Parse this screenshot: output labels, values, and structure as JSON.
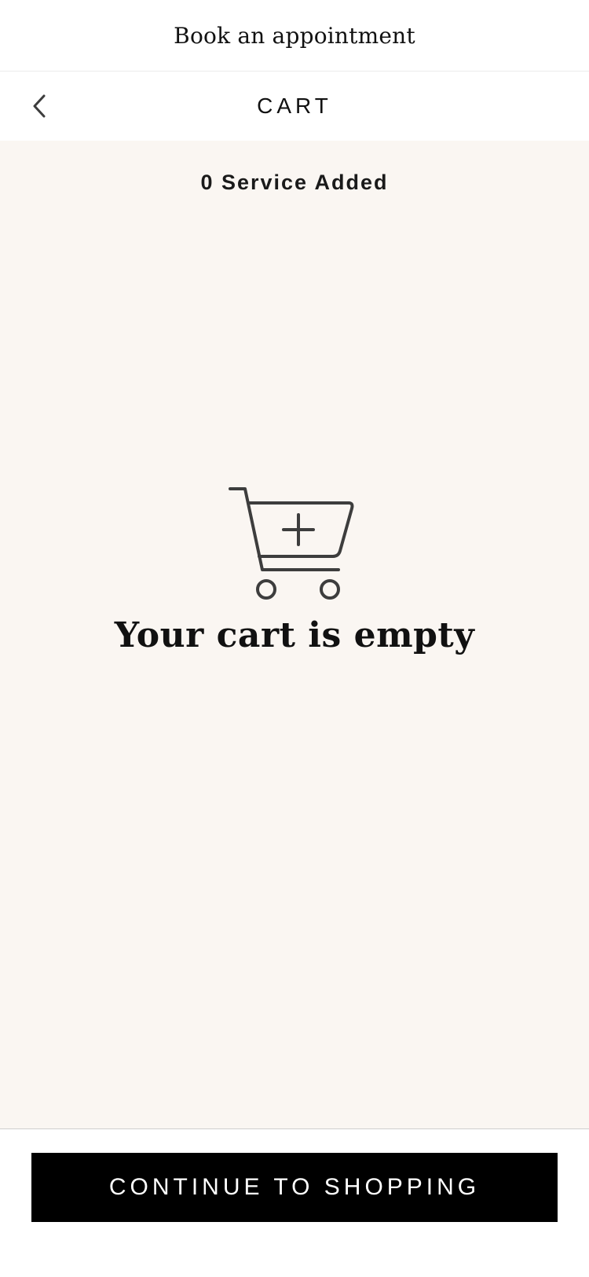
{
  "topbar": {
    "title": "Book an appointment"
  },
  "header": {
    "back_icon": "chevron-left-icon",
    "title": "CART"
  },
  "cart": {
    "service_count_text": "0 Service Added",
    "empty_icon": "cart-plus-icon",
    "empty_title": "Your cart is empty"
  },
  "footer": {
    "continue_label": "CONTINUE TO SHOPPING"
  },
  "colors": {
    "main_background": "#faf6f2",
    "button_background": "#000000",
    "button_text": "#ffffff",
    "icon_stroke": "#3d3d3d"
  }
}
